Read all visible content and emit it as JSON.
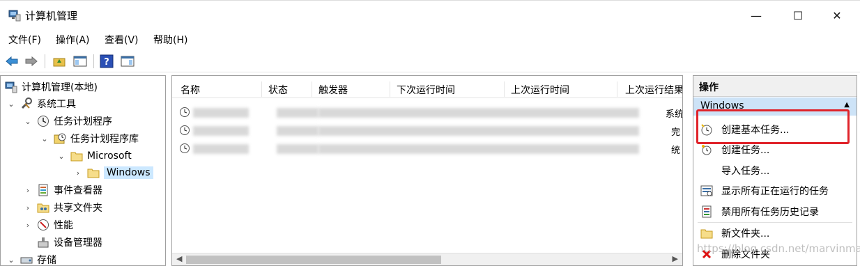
{
  "window": {
    "title": "计算机管理",
    "min_glyph": "—",
    "max_glyph": "☐",
    "close_glyph": "✕"
  },
  "menu": {
    "items": [
      "文件(F)",
      "操作(A)",
      "查看(V)",
      "帮助(H)"
    ]
  },
  "tree": {
    "items": [
      {
        "label": "计算机管理(本地)",
        "icon": "computer-management-icon"
      },
      {
        "label": "系统工具",
        "icon": "tools-icon"
      },
      {
        "label": "任务计划程序",
        "icon": "clock-icon"
      },
      {
        "label": "任务计划程序库",
        "icon": "task-library-icon"
      },
      {
        "label": "Microsoft",
        "icon": "folder-icon"
      },
      {
        "label": "Windows",
        "icon": "folder-icon"
      },
      {
        "label": "事件查看器",
        "icon": "event-viewer-icon"
      },
      {
        "label": "共享文件夹",
        "icon": "shared-folder-icon"
      },
      {
        "label": "性能",
        "icon": "performance-icon"
      },
      {
        "label": "设备管理器",
        "icon": "device-manager-icon"
      },
      {
        "label": "存储",
        "icon": "storage-icon"
      }
    ]
  },
  "table": {
    "columns": [
      "名称",
      "状态",
      "触发器",
      "下次运行时间",
      "上次运行时间",
      "上次运行结果"
    ],
    "partial_result": [
      "系统",
      "完",
      "统"
    ]
  },
  "actions": {
    "header": "操作",
    "group": "Windows",
    "items": [
      {
        "label": "创建基本任务...",
        "icon": "create-basic-task-icon"
      },
      {
        "label": "创建任务...",
        "icon": "create-task-icon"
      },
      {
        "label": "导入任务...",
        "icon": ""
      },
      {
        "label": "显示所有正在运行的任务",
        "icon": "running-tasks-icon"
      },
      {
        "label": "禁用所有任务历史记录",
        "icon": "history-icon"
      },
      {
        "label": "新文件夹...",
        "icon": "new-folder-icon"
      },
      {
        "label": "删除文件夹",
        "icon": "delete-icon"
      }
    ]
  },
  "watermark": "https://blog.csdn.net/marvinmao",
  "colors": {
    "highlight_border": "#e0232a",
    "selected_group": "#cde3f7",
    "selected_tree": "#cce8ff"
  }
}
